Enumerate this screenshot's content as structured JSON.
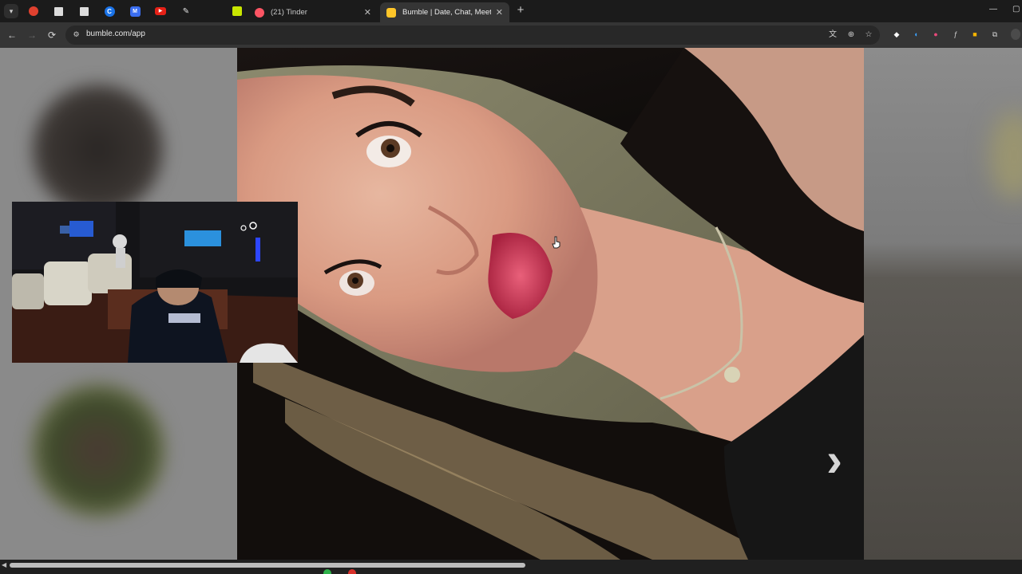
{
  "tabs": [
    {
      "title": "(21) Tinder",
      "favicon_color": "#fd5564",
      "active": false
    },
    {
      "title": "Bumble | Date, Chat, Meet New",
      "favicon_color": "#ffc629",
      "active": true
    }
  ],
  "tab_close_glyph": "✕",
  "new_tab_glyph": "+",
  "window_controls": {
    "minimize": "—",
    "maximize": "▢"
  },
  "pinned_tabs": [
    {
      "icon": "brave-icon",
      "color": "#e0412f",
      "glyph": "●"
    },
    {
      "icon": "page-icon",
      "color": "#dcdcdc",
      "glyph": ""
    },
    {
      "icon": "page-icon",
      "color": "#dcdcdc",
      "glyph": ""
    },
    {
      "icon": "c-icon",
      "color": "#1a73e8",
      "glyph": "C"
    },
    {
      "icon": "m-icon",
      "color": "#3b6ef0",
      "glyph": "M"
    },
    {
      "icon": "youtube-icon",
      "color": "#e62117",
      "glyph": "▶"
    },
    {
      "icon": "tool-icon",
      "color": "#555555",
      "glyph": "✎"
    },
    {
      "icon": "blank-icon",
      "color": "#1b1b1b",
      "glyph": ""
    },
    {
      "icon": "green-square-icon",
      "color": "#c8e600",
      "glyph": "▣"
    }
  ],
  "toolbar": {
    "back_glyph": "←",
    "forward_glyph": "→",
    "reload_glyph": "⟳",
    "url": "bumble.com/app",
    "site_info_glyph": "⚙",
    "translate_glyph": "文",
    "zoom_glyph": "⊕",
    "bookmark_glyph": "☆"
  },
  "extensions": [
    {
      "icon": "diamond-icon",
      "color": "#ffffff",
      "glyph": "◆"
    },
    {
      "icon": "audio-icon",
      "color": "#3aa0ff",
      "glyph": "◖"
    },
    {
      "icon": "shield-icon",
      "color": "#e8487a",
      "glyph": "●"
    },
    {
      "icon": "script-icon",
      "color": "#cfcfcf",
      "glyph": "ƒ"
    },
    {
      "icon": "lock-icon",
      "color": "#f5b400",
      "glyph": "■"
    },
    {
      "icon": "puzzle-icon",
      "color": "#cfcfcf",
      "glyph": "⧉"
    }
  ],
  "photo_nav": {
    "next_glyph": "›"
  },
  "colors": {
    "accent_bumble": "#ffc629",
    "accent_tinder": "#fd5564"
  }
}
